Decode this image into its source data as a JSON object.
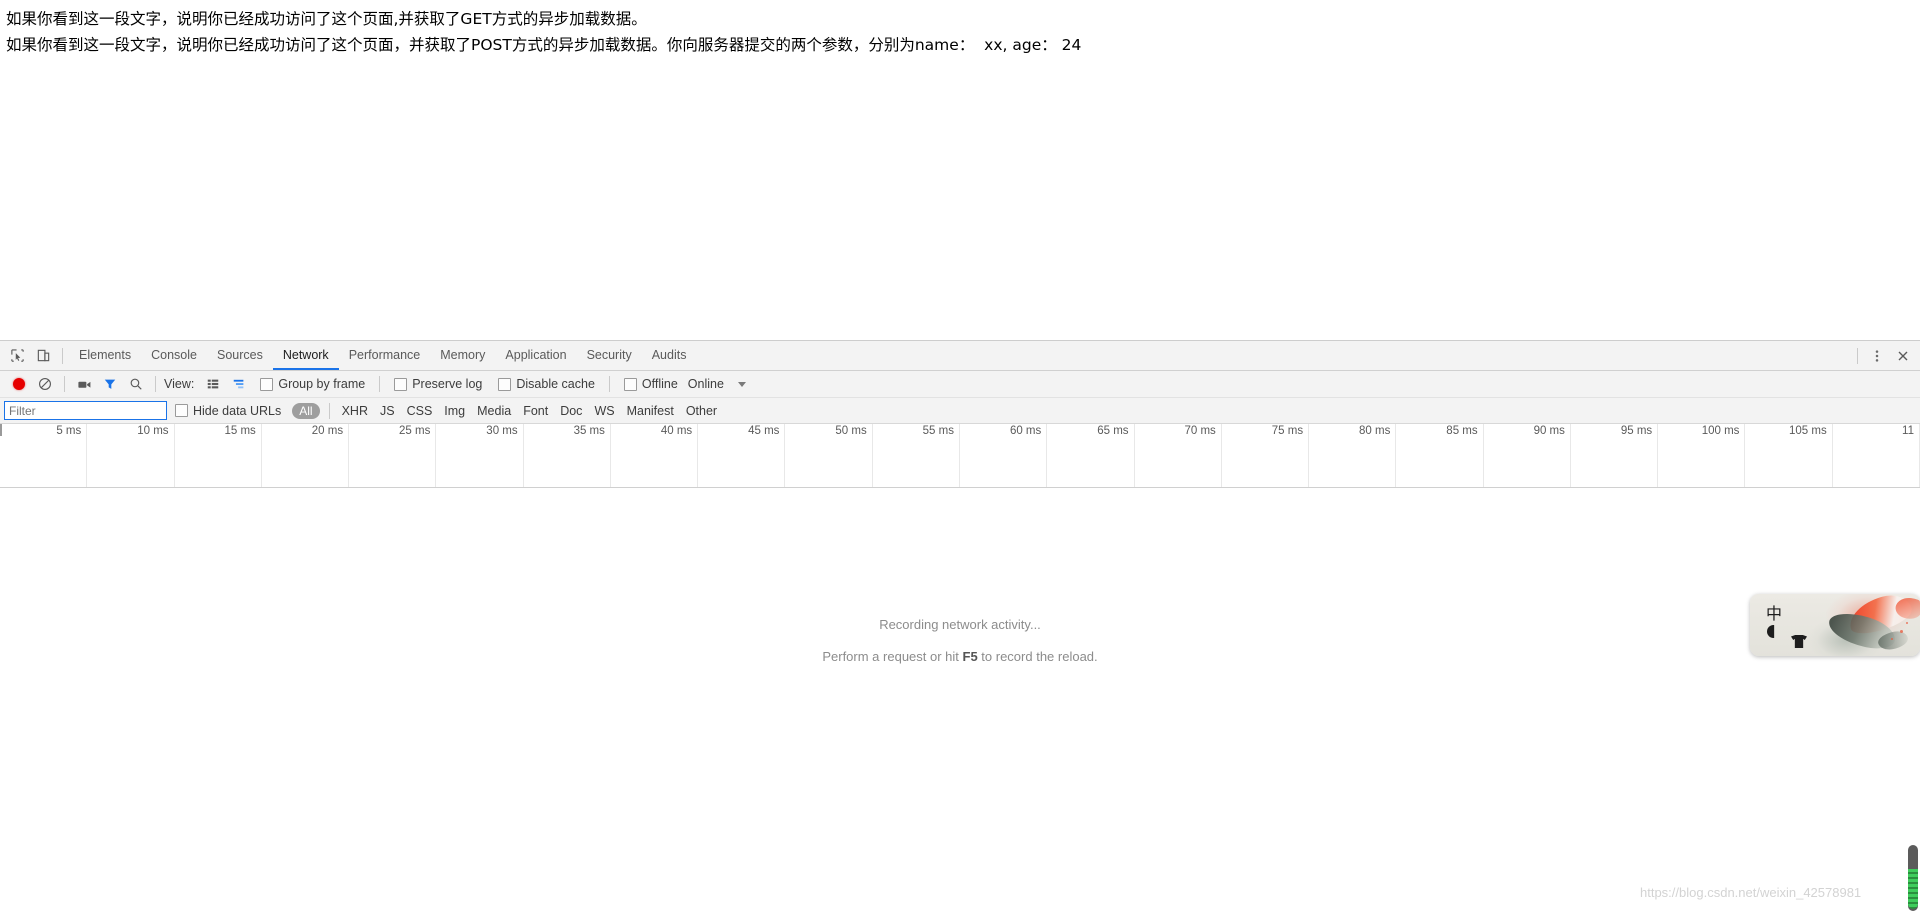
{
  "page": {
    "lines": [
      "如果你看到这一段文字，说明你已经成功访问了这个页面,并获取了GET方式的异步加载数据。",
      "如果你看到这一段文字，说明你已经成功访问了这个页面，并获取了POST方式的异步加载数据。你向服务器提交的两个参数，分别为name：  xx, age： 24"
    ]
  },
  "devtools": {
    "tabs": [
      {
        "label": "Elements",
        "selected": false
      },
      {
        "label": "Console",
        "selected": false
      },
      {
        "label": "Sources",
        "selected": false
      },
      {
        "label": "Network",
        "selected": true
      },
      {
        "label": "Performance",
        "selected": false
      },
      {
        "label": "Memory",
        "selected": false
      },
      {
        "label": "Application",
        "selected": false
      },
      {
        "label": "Security",
        "selected": false
      },
      {
        "label": "Audits",
        "selected": false
      }
    ],
    "accent_color": "#1a73e8",
    "record_color": "#e60000",
    "icons": {
      "inspect": "inspect-element-icon",
      "device": "device-toolbar-icon",
      "record": "record-icon",
      "clear": "clear-icon",
      "capture": "capture-screenshots-icon",
      "filter": "filter-icon",
      "search": "search-icon",
      "menu": "more-options-icon",
      "close": "close-icon"
    },
    "toolbar": {
      "view_label": "View:",
      "group_by_frame": "Group by frame",
      "preserve_log": "Preserve log",
      "disable_cache": "Disable cache",
      "offline": "Offline",
      "online": "Online"
    },
    "filterbar": {
      "filter_placeholder": "Filter",
      "filter_value": "",
      "hide_data_urls": "Hide data URLs",
      "types": [
        "All",
        "XHR",
        "JS",
        "CSS",
        "Img",
        "Media",
        "Font",
        "Doc",
        "WS",
        "Manifest",
        "Other"
      ],
      "selected_type": "All"
    },
    "timeline": {
      "labels": [
        "5 ms",
        "10 ms",
        "15 ms",
        "20 ms",
        "25 ms",
        "30 ms",
        "35 ms",
        "40 ms",
        "45 ms",
        "50 ms",
        "55 ms",
        "60 ms",
        "65 ms",
        "70 ms",
        "75 ms",
        "80 ms",
        "85 ms",
        "90 ms",
        "95 ms",
        "100 ms",
        "105 ms",
        "11"
      ]
    },
    "empty_state": {
      "title": "Recording network activity...",
      "sub_prefix": "Perform a request or hit ",
      "sub_key": "F5",
      "sub_suffix": " to record the reload."
    }
  },
  "ime": {
    "language_glyph": "中",
    "moon_icon": "moon-icon",
    "skin_icon": "skin-icon"
  },
  "watermark": {
    "text": "https://blog.csdn.net/weixin_42578981"
  }
}
